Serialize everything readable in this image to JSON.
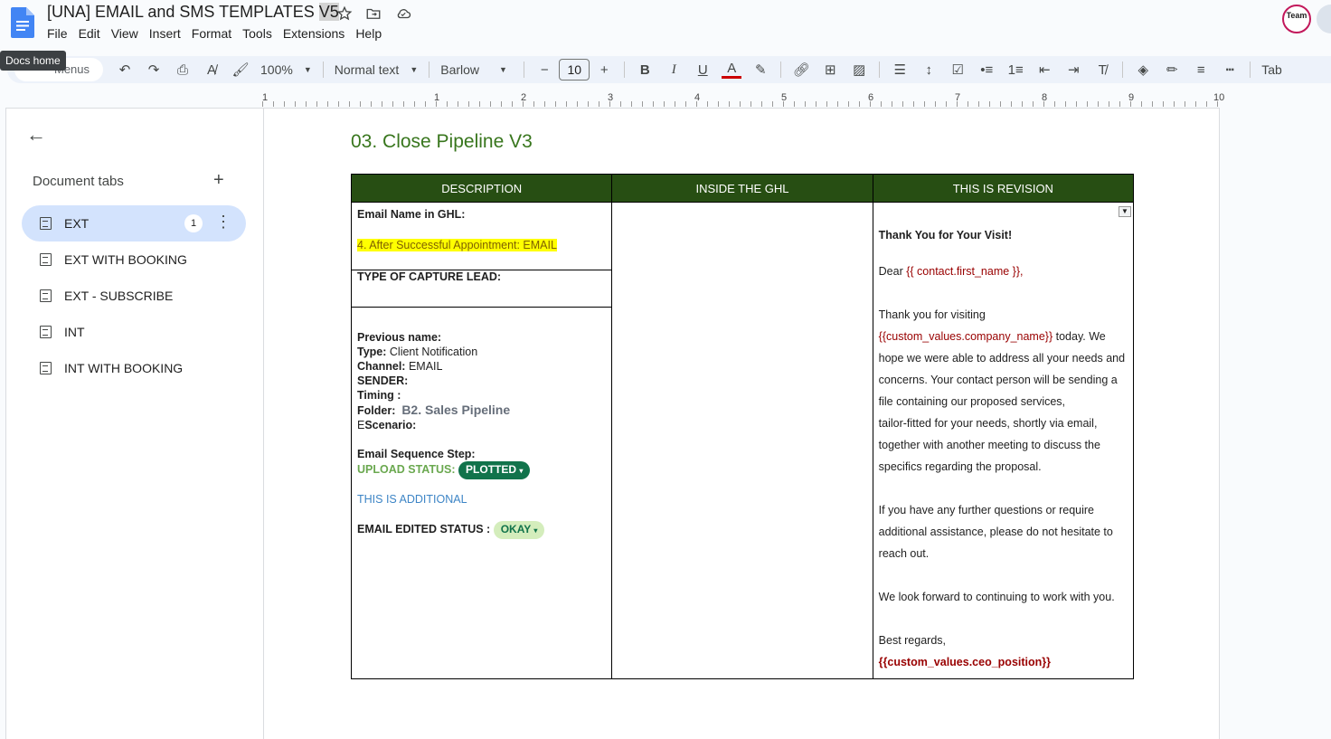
{
  "header": {
    "title_main": "[UNA] EMAIL and SMS TEMPLATES ",
    "title_version": "V5",
    "menu": [
      "File",
      "Edit",
      "View",
      "Insert",
      "Format",
      "Tools",
      "Extensions",
      "Help"
    ],
    "avatar_text": "Team",
    "tooltip": "Docs home"
  },
  "toolbar": {
    "search_placeholder": "Menus",
    "zoom": "100%",
    "style": "Normal text",
    "font": "Barlow",
    "font_size": "10",
    "tabs_label": "Tab"
  },
  "ruler": {
    "numbers": [
      "1",
      "1",
      "2",
      "3",
      "4",
      "5",
      "6",
      "7",
      "8",
      "9",
      "10"
    ]
  },
  "sidebar": {
    "heading": "Document tabs",
    "tabs": [
      {
        "label": "EXT",
        "badge": "1",
        "active": true
      },
      {
        "label": "EXT WITH BOOKING"
      },
      {
        "label": "EXT - SUBSCRIBE"
      },
      {
        "label": "INT"
      },
      {
        "label": "INT WITH BOOKING"
      }
    ]
  },
  "doc": {
    "heading": "03. Close Pipeline V3",
    "table": {
      "headers": [
        "DESCRIPTION",
        "INSIDE THE GHL",
        "THIS IS REVISION"
      ],
      "desc": {
        "email_name_label": "Email Name in GHL:",
        "email_name_value": "4. After Successful Appointment: EMAIL",
        "capture_label": "TYPE OF CAPTURE LEAD:",
        "previous_name_label": "Previous name:",
        "type_label": "Type:",
        "type_value": " Client Notification",
        "channel_label": "Channel:",
        "channel_value": " EMAIL",
        "sender_label": "SENDER:",
        "timing_label": "Timing :",
        "folder_label": "Folder:",
        "folder_value": "B2. Sales Pipeline",
        "scenario_prefix": "E",
        "scenario_label": "Scenario:",
        "sequence_label": "Email Sequence Step:",
        "upload_label": "UPLOAD STATUS:",
        "upload_chip": "PLOTTED",
        "additional": "THIS IS ADDITIONAL",
        "edited_label": "EMAIL EDITED STATUS :",
        "edited_chip": "OKAY"
      },
      "revision": {
        "subject": "Thank You for Your Visit!",
        "greeting": "Dear ",
        "greeting_var": "{{ contact.first_name }},",
        "p1_a": "Thank you for visiting",
        "p1_var": "{{custom_values.company_name}}",
        "p1_b": " today. We",
        "p1_lines": [
          "hope we were able to address all your needs and",
          "concerns. Your contact person will be sending a",
          "file containing our proposed services,",
          "tailor-fitted for your needs, shortly via email,",
          "together with another meeting to discuss the",
          "specifics regarding the proposal."
        ],
        "p2_lines": [
          "If you have any further questions or require",
          "additional assistance, please do not hesitate to",
          "reach out."
        ],
        "p3": "We look forward to continuing to work with you.",
        "closing": "Best regards,",
        "signature": "{{custom_values.ceo_position}}"
      }
    }
  }
}
